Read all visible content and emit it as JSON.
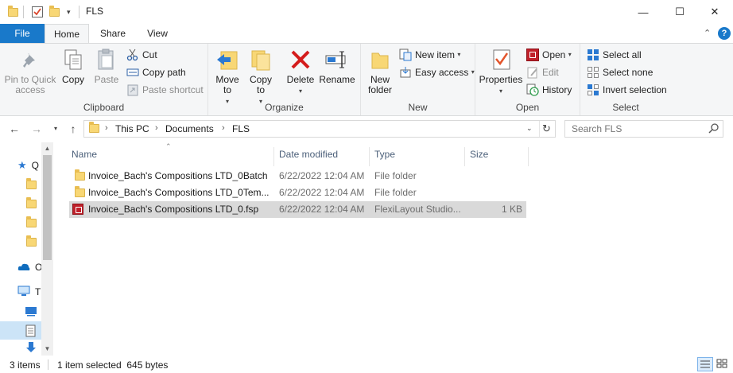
{
  "window": {
    "title": "FLS",
    "minimize": "—",
    "maximize": "☐",
    "close": "✕"
  },
  "ribbon_tabs": [
    {
      "label": "File"
    },
    {
      "label": "Home"
    },
    {
      "label": "Share"
    },
    {
      "label": "View"
    }
  ],
  "ribbon": {
    "clipboard": {
      "label": "Clipboard",
      "pin": "Pin to Quick access",
      "copy": "Copy",
      "paste": "Paste",
      "cut": "Cut",
      "copy_path": "Copy path",
      "paste_shortcut": "Paste shortcut"
    },
    "organize": {
      "label": "Organize",
      "move_to": "Move to",
      "copy_to": "Copy to",
      "delete": "Delete",
      "rename": "Rename"
    },
    "new": {
      "label": "New",
      "new_folder": "New folder",
      "new_item": "New item",
      "easy_access": "Easy access"
    },
    "open": {
      "label": "Open",
      "properties": "Properties",
      "open": "Open",
      "edit": "Edit",
      "history": "History"
    },
    "select": {
      "label": "Select",
      "select_all": "Select all",
      "select_none": "Select none",
      "invert": "Invert selection"
    }
  },
  "address": {
    "breadcrumbs": [
      "This PC",
      "Documents",
      "FLS"
    ],
    "search_placeholder": "Search FLS"
  },
  "navpane": {
    "items": [
      "Q",
      "",
      "",
      "",
      "",
      "O",
      "T",
      "",
      "",
      ""
    ]
  },
  "columns": {
    "name": "Name",
    "date": "Date modified",
    "type": "Type",
    "size": "Size"
  },
  "files": [
    {
      "name": "Invoice_Bach's Compositions LTD_0Batch",
      "date": "6/22/2022 12:04 AM",
      "type": "File folder",
      "size": "",
      "icon": "folder-icon"
    },
    {
      "name": "Invoice_Bach's Compositions LTD_0Tem...",
      "date": "6/22/2022 12:04 AM",
      "type": "File folder",
      "size": "",
      "icon": "folder-icon"
    },
    {
      "name": "Invoice_Bach's Compositions LTD_0.fsp",
      "date": "6/22/2022 12:04 AM",
      "type": "FlexiLayout Studio...",
      "size": "1 KB",
      "icon": "flexilayout-file-icon",
      "selected": true
    }
  ],
  "status": {
    "items_count": "3 items",
    "selection": "1 item selected  645 bytes"
  },
  "colors": {
    "file_tab": "#1979ca",
    "ribbon_bg": "#f5f6f7",
    "selected_row": "#d9d9d9",
    "header_text": "#4c607a"
  }
}
